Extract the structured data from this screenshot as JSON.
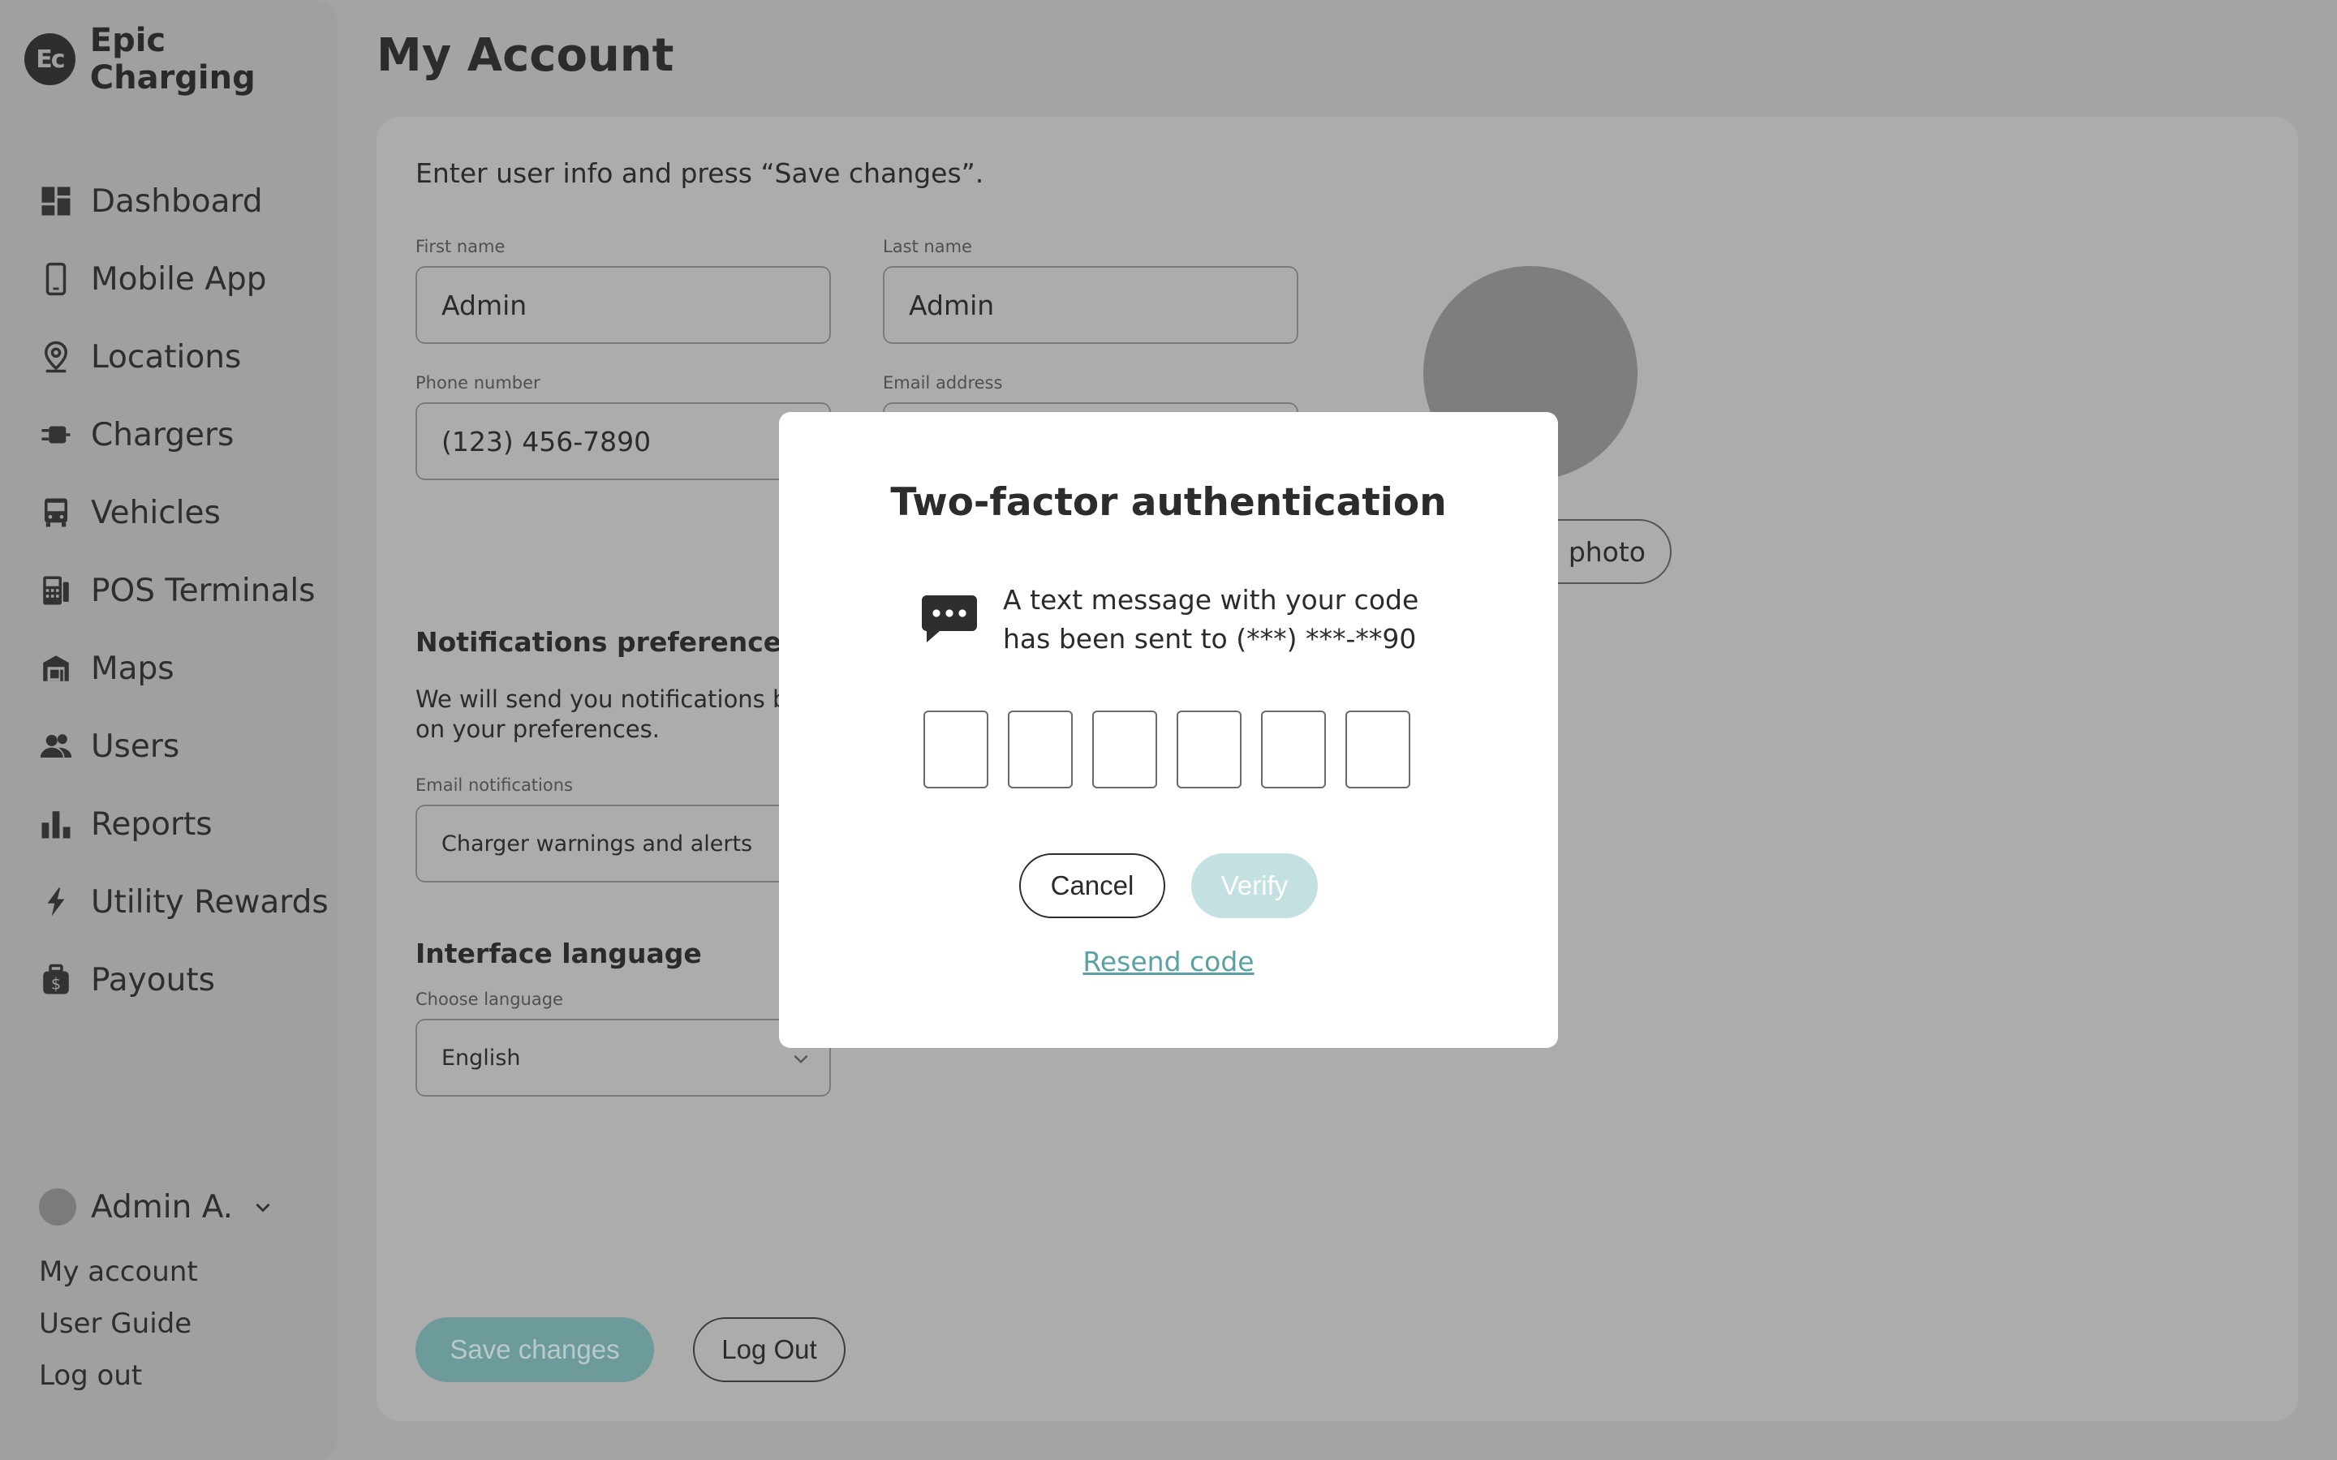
{
  "app": {
    "brand_initials": "Ec",
    "brand_name": "Epic Charging"
  },
  "sidebar": {
    "items": [
      {
        "label": "Dashboard",
        "icon": "dashboard-icon"
      },
      {
        "label": "Mobile App",
        "icon": "mobile-phone-icon"
      },
      {
        "label": "Locations",
        "icon": "location-pin-icon"
      },
      {
        "label": "Chargers",
        "icon": "charger-plug-icon"
      },
      {
        "label": "Vehicles",
        "icon": "bus-icon"
      },
      {
        "label": "POS Terminals",
        "icon": "pos-terminal-icon"
      },
      {
        "label": "Maps",
        "icon": "map-building-icon"
      },
      {
        "label": "Users",
        "icon": "users-icon"
      },
      {
        "label": "Reports",
        "icon": "bar-chart-icon"
      },
      {
        "label": "Utility Rewards",
        "icon": "lightning-bolt-icon"
      },
      {
        "label": "Payouts",
        "icon": "money-bag-icon"
      }
    ],
    "user": {
      "name": "Admin A.",
      "links": [
        "My account",
        "User Guide",
        "Log out"
      ]
    }
  },
  "page": {
    "title": "My Account",
    "intro": "Enter user info and press “Save changes”.",
    "first_name": {
      "label": "First name",
      "value": "Admin"
    },
    "last_name": {
      "label": "Last name",
      "value": "Admin"
    },
    "phone": {
      "label": "Phone number",
      "value": "(123) 456-7890"
    },
    "email": {
      "label": "Email address",
      "value": ""
    },
    "upload_photo_label": "l photo",
    "notifications": {
      "title": "Notifications preferences",
      "description": "We will send you notifications ba on your preferences.",
      "email_label": "Email notifications",
      "email_value": "Charger warnings and alerts"
    },
    "language": {
      "title": "Interface language",
      "label": "Choose language",
      "value": "English"
    },
    "save_label": "Save changes",
    "logout_label": "Log Out"
  },
  "modal": {
    "title": "Two-factor authentication",
    "message_line1": "A text message with your code",
    "message_line2": "has been sent to (***) ***-**90",
    "code_length": 6,
    "cancel_label": "Cancel",
    "verify_label": "Verify",
    "resend_label": "Resend code"
  },
  "colors": {
    "overlay_background": "#a4a4a4",
    "accent_teal": "#5aa1a3",
    "verify_disabled": "#c4e1e2",
    "save_button": "#6d9a9a"
  }
}
